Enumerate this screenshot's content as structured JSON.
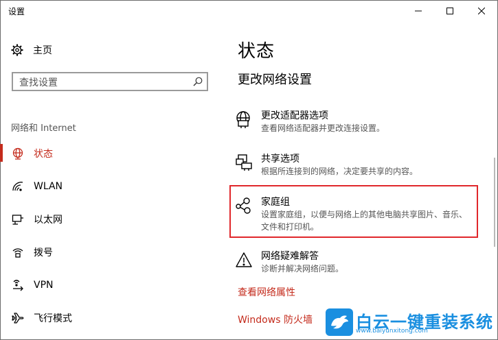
{
  "window": {
    "title": "设置",
    "minimize_icon": "minimize-icon",
    "maximize_icon": "maximize-icon",
    "close_icon": "close-icon"
  },
  "sidebar": {
    "home_label": "主页",
    "search_placeholder": "查找设置",
    "section_label": "网络和 Internet",
    "items": [
      {
        "label": "状态",
        "icon": "globe-icon",
        "active": true
      },
      {
        "label": "WLAN",
        "icon": "wifi-icon",
        "active": false
      },
      {
        "label": "以太网",
        "icon": "ethernet-icon",
        "active": false
      },
      {
        "label": "拨号",
        "icon": "dialup-icon",
        "active": false
      },
      {
        "label": "VPN",
        "icon": "vpn-icon",
        "active": false
      },
      {
        "label": "飞行模式",
        "icon": "airplane-icon",
        "active": false
      }
    ]
  },
  "main": {
    "title": "状态",
    "subtitle": "更改网络设置",
    "options": [
      {
        "title": "更改适配器选项",
        "desc": "查看网络适配器并更改连接设置。",
        "icon": "adapter-icon"
      },
      {
        "title": "共享选项",
        "desc": "根据所连接到的网络，决定要共享的内容。",
        "icon": "sharing-icon"
      },
      {
        "title": "家庭组",
        "desc": "设置家庭组，以便与网络上的其他电脑共享图片、音乐、文件和打印机。",
        "icon": "homegroup-icon"
      },
      {
        "title": "网络疑难解答",
        "desc": "诊断并解决网络问题。",
        "icon": "warning-icon"
      }
    ],
    "links": [
      "查看网络属性",
      "Windows 防火墙"
    ]
  },
  "watermark": {
    "text": "白云一键重装系统",
    "url": "www.baiyunxitong.com"
  },
  "colors": {
    "accent": "#c42b1c",
    "highlight_box": "#e0262a",
    "watermark": "#1a8fe0"
  }
}
